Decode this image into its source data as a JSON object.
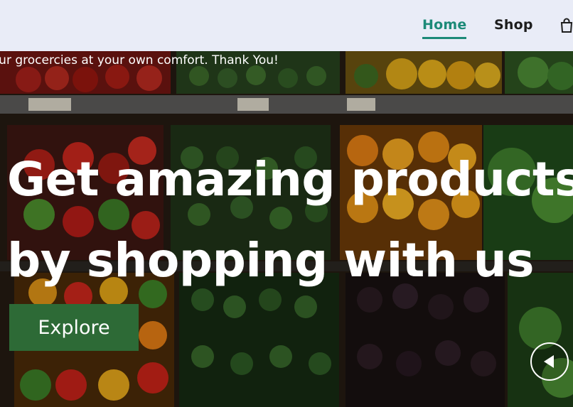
{
  "nav": {
    "items": [
      {
        "label": "Home",
        "active": true
      },
      {
        "label": "Shop",
        "active": false
      }
    ],
    "cart_icon": "shopping-bag-icon",
    "bar_color": "#e9ecf7",
    "active_color": "#1c8a78"
  },
  "hero": {
    "marquee": "Get your grocercies at your own comfort. Thank You!",
    "headline_line1": "Get amazing products",
    "headline_line2": "by shopping with us",
    "cta_label": "Explore",
    "cta_color": "#2d6a36",
    "prev_icon": "play-left-icon",
    "background": "grocery-vegetable-shelves-photo"
  }
}
